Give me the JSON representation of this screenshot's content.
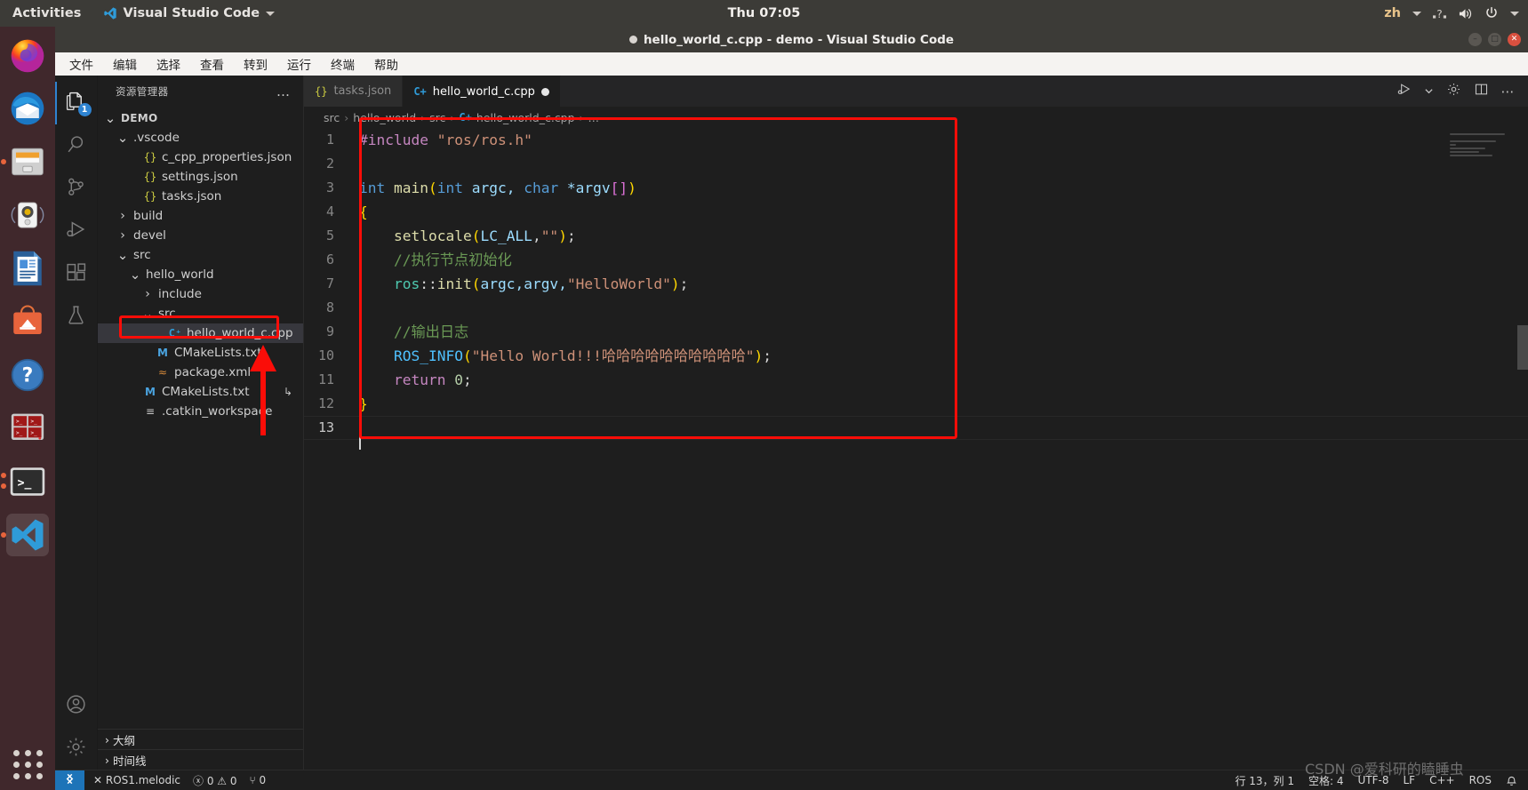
{
  "gnome": {
    "activities": "Activities",
    "app_name": "Visual Studio Code",
    "clock": "Thu 07:05",
    "keyboard_layout": "zh",
    "tray_icons": [
      "help-icon",
      "volume-icon",
      "power-icon",
      "chevron-down-icon"
    ]
  },
  "dock": {
    "items": [
      {
        "name": "firefox",
        "label": "Firefox",
        "running": false
      },
      {
        "name": "thunderbird",
        "label": "Thunderbird Mail",
        "running": false
      },
      {
        "name": "files",
        "label": "Files",
        "running": true
      },
      {
        "name": "rhythmbox",
        "label": "Rhythmbox",
        "running": false
      },
      {
        "name": "libreoffice-writer",
        "label": "LibreOffice Writer",
        "running": false
      },
      {
        "name": "ubuntu-software",
        "label": "Ubuntu Software",
        "running": false
      },
      {
        "name": "help",
        "label": "Help",
        "running": false
      },
      {
        "name": "terminator",
        "label": "Terminator",
        "running": false
      },
      {
        "name": "terminal",
        "label": "Terminal",
        "running": true
      },
      {
        "name": "vscode",
        "label": "Visual Studio Code",
        "running": true,
        "active": true
      }
    ],
    "show_apps_label": "Show Applications"
  },
  "window": {
    "title": "hello_world_c.cpp - demo - Visual Studio Code",
    "modified": true,
    "buttons": {
      "minimize": "–",
      "maximize": "□",
      "close": "✕"
    }
  },
  "menubar": {
    "items": [
      "文件",
      "编辑",
      "选择",
      "查看",
      "转到",
      "运行",
      "终端",
      "帮助"
    ]
  },
  "activitybar": {
    "items": [
      {
        "name": "explorer",
        "icon": "files-icon",
        "active": true,
        "badge": "1"
      },
      {
        "name": "search",
        "icon": "search-icon",
        "active": false,
        "badge": ""
      },
      {
        "name": "source-control",
        "icon": "source-control-icon",
        "active": false,
        "badge": ""
      },
      {
        "name": "run-debug",
        "icon": "run-debug-icon",
        "active": false,
        "badge": ""
      },
      {
        "name": "extensions",
        "icon": "extensions-icon",
        "active": false,
        "badge": ""
      },
      {
        "name": "testing",
        "icon": "beaker-icon",
        "active": false,
        "badge": ""
      }
    ],
    "bottom": [
      {
        "name": "accounts",
        "icon": "account-icon"
      },
      {
        "name": "manage",
        "icon": "gear-icon"
      }
    ]
  },
  "sidebar": {
    "header_title": "资源管理器",
    "header_more": "…",
    "tree": [
      {
        "label": "DEMO",
        "indent": 0,
        "twisty": "down",
        "icon": "",
        "root": true,
        "selected": false,
        "mark": ""
      },
      {
        "label": ".vscode",
        "indent": 1,
        "twisty": "down",
        "icon": "",
        "root": false,
        "selected": false,
        "mark": ""
      },
      {
        "label": "c_cpp_properties.json",
        "indent": 2,
        "twisty": "",
        "icon": "json",
        "root": false,
        "selected": false,
        "mark": ""
      },
      {
        "label": "settings.json",
        "indent": 2,
        "twisty": "",
        "icon": "json",
        "root": false,
        "selected": false,
        "mark": ""
      },
      {
        "label": "tasks.json",
        "indent": 2,
        "twisty": "",
        "icon": "json",
        "root": false,
        "selected": false,
        "mark": ""
      },
      {
        "label": "build",
        "indent": 1,
        "twisty": "right",
        "icon": "",
        "root": false,
        "selected": false,
        "mark": ""
      },
      {
        "label": "devel",
        "indent": 1,
        "twisty": "right",
        "icon": "",
        "root": false,
        "selected": false,
        "mark": ""
      },
      {
        "label": "src",
        "indent": 1,
        "twisty": "down",
        "icon": "",
        "root": false,
        "selected": false,
        "mark": ""
      },
      {
        "label": "hello_world",
        "indent": 2,
        "twisty": "down",
        "icon": "",
        "root": false,
        "selected": false,
        "mark": ""
      },
      {
        "label": "include",
        "indent": 3,
        "twisty": "right",
        "icon": "",
        "root": false,
        "selected": false,
        "mark": ""
      },
      {
        "label": "src",
        "indent": 3,
        "twisty": "down",
        "icon": "",
        "root": false,
        "selected": false,
        "mark": ""
      },
      {
        "label": "hello_world_c.cpp",
        "indent": 4,
        "twisty": "",
        "icon": "cpp",
        "root": false,
        "selected": true,
        "mark": ""
      },
      {
        "label": "CMakeLists.txt",
        "indent": 3,
        "twisty": "",
        "icon": "m",
        "root": false,
        "selected": false,
        "mark": ""
      },
      {
        "label": "package.xml",
        "indent": 3,
        "twisty": "",
        "icon": "xml",
        "root": false,
        "selected": false,
        "mark": ""
      },
      {
        "label": "CMakeLists.txt",
        "indent": 2,
        "twisty": "",
        "icon": "m",
        "root": false,
        "selected": false,
        "mark": "↳"
      },
      {
        "label": ".catkin_workspace",
        "indent": 2,
        "twisty": "",
        "icon": "list",
        "root": false,
        "selected": false,
        "mark": ""
      }
    ],
    "panels": [
      {
        "label": "大纲",
        "expanded": false
      },
      {
        "label": "时间线",
        "expanded": false
      }
    ]
  },
  "editor": {
    "tabs": [
      {
        "label": "tasks.json",
        "icon": "json-icon",
        "active": false,
        "dirty": false
      },
      {
        "label": "hello_world_c.cpp",
        "icon": "cpp-icon",
        "active": true,
        "dirty": true
      }
    ],
    "tab_actions": [
      "run-debug-icon",
      "chevron-down-icon",
      "gear-icon",
      "split-editor-icon",
      "more-actions-icon"
    ],
    "breadcrumbs": [
      "src",
      "hello_world",
      "src",
      "hello_world_c.cpp",
      "…"
    ],
    "code_lines": [
      {
        "num": "1",
        "tokens": [
          {
            "t": "#include ",
            "c": "t-key"
          },
          {
            "t": "\"ros/ros.h\"",
            "c": "t-str"
          }
        ]
      },
      {
        "num": "2",
        "tokens": []
      },
      {
        "num": "3",
        "tokens": [
          {
            "t": "int ",
            "c": "t-type"
          },
          {
            "t": "main",
            "c": "t-fn"
          },
          {
            "t": "(",
            "c": "t-brace-y"
          },
          {
            "t": "int",
            "c": "t-type"
          },
          {
            "t": " argc, ",
            "c": "t-var"
          },
          {
            "t": "char",
            "c": "t-type"
          },
          {
            "t": " *argv",
            "c": "t-var"
          },
          {
            "t": "[]",
            "c": "t-brace-p"
          },
          {
            "t": ")",
            "c": "t-brace-y"
          }
        ]
      },
      {
        "num": "4",
        "tokens": [
          {
            "t": "{",
            "c": "t-brace-y"
          }
        ]
      },
      {
        "num": "5",
        "tokens": [
          {
            "t": "    ",
            "c": "t-plain"
          },
          {
            "t": "setlocale",
            "c": "t-fn"
          },
          {
            "t": "(",
            "c": "t-brace-y"
          },
          {
            "t": "LC_ALL",
            "c": "t-var"
          },
          {
            "t": ",",
            "c": "t-plain"
          },
          {
            "t": "\"\"",
            "c": "t-str"
          },
          {
            "t": ")",
            "c": "t-brace-y"
          },
          {
            "t": ";",
            "c": "t-plain"
          }
        ]
      },
      {
        "num": "6",
        "tokens": [
          {
            "t": "    //执行节点初始化",
            "c": "t-cmt"
          }
        ]
      },
      {
        "num": "7",
        "tokens": [
          {
            "t": "    ",
            "c": "t-plain"
          },
          {
            "t": "ros",
            "c": "t-ns"
          },
          {
            "t": "::",
            "c": "t-plain"
          },
          {
            "t": "init",
            "c": "t-fn"
          },
          {
            "t": "(",
            "c": "t-brace-y"
          },
          {
            "t": "argc,argv,",
            "c": "t-var"
          },
          {
            "t": "\"HelloWorld\"",
            "c": "t-str"
          },
          {
            "t": ")",
            "c": "t-brace-y"
          },
          {
            "t": ";",
            "c": "t-plain"
          }
        ]
      },
      {
        "num": "8",
        "tokens": []
      },
      {
        "num": "9",
        "tokens": [
          {
            "t": "    //输出日志",
            "c": "t-cmt"
          }
        ]
      },
      {
        "num": "10",
        "tokens": [
          {
            "t": "    ",
            "c": "t-plain"
          },
          {
            "t": "ROS_INFO",
            "c": "t-macro"
          },
          {
            "t": "(",
            "c": "t-brace-y"
          },
          {
            "t": "\"Hello World!!!哈哈哈哈哈哈哈哈哈哈\"",
            "c": "t-str"
          },
          {
            "t": ")",
            "c": "t-brace-y"
          },
          {
            "t": ";",
            "c": "t-plain"
          }
        ]
      },
      {
        "num": "11",
        "tokens": [
          {
            "t": "    ",
            "c": "t-plain"
          },
          {
            "t": "return",
            "c": "t-key"
          },
          {
            "t": " ",
            "c": "t-plain"
          },
          {
            "t": "0",
            "c": "t-num"
          },
          {
            "t": ";",
            "c": "t-plain"
          }
        ]
      },
      {
        "num": "12",
        "tokens": [
          {
            "t": "}",
            "c": "t-brace-y"
          }
        ]
      },
      {
        "num": "13",
        "tokens": [],
        "current": true
      }
    ]
  },
  "statusbar": {
    "remote_icon": "remote-window-icon",
    "left": [
      {
        "name": "ros-distro",
        "label": "✕ ROS1.melodic"
      },
      {
        "name": "problems",
        "label": "ⓧ 0  ⚠ 0"
      },
      {
        "name": "ports",
        "label": "⑂ 0"
      }
    ],
    "right": [
      {
        "name": "cursor-position",
        "label": "行 13，列 1"
      },
      {
        "name": "indentation",
        "label": "空格: 4"
      },
      {
        "name": "encoding",
        "label": "UTF-8"
      },
      {
        "name": "eol",
        "label": "LF"
      },
      {
        "name": "language-mode",
        "label": "C++"
      },
      {
        "name": "ros-status",
        "label": "ROS"
      },
      {
        "name": "notifications",
        "label": "🔔"
      }
    ]
  },
  "annotations": {
    "highlight_color": "#fb0d08",
    "file_box_label": "hello_world_c.cpp",
    "editor_box_label": "code-region",
    "arrow_label": "points-to-selected-file"
  },
  "watermark": {
    "text": "CSDN @爱科研的瞌睡虫"
  }
}
